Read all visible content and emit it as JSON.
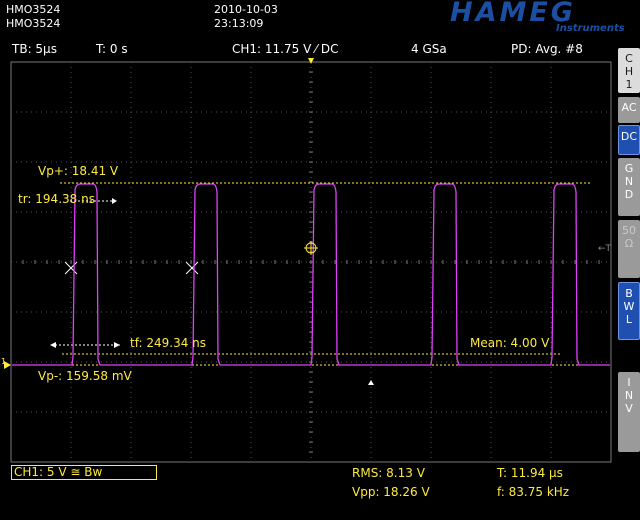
{
  "header": {
    "device_line1": "HMO3524",
    "device_line2": "HMO3524",
    "date": "2010-10-03",
    "time": "23:13:09",
    "brand": "HAMEG",
    "brand_sub": "Instruments"
  },
  "status_bar": {
    "timebase": "TB: 5µs",
    "trigger_time": "T: 0 s",
    "channel_setting": "CH1: 11.75 V ⁄ DC",
    "sample_rate": "4 GSa",
    "acquisition": "PD: Avg. #8"
  },
  "side_menu": {
    "ch1": [
      "C",
      "H",
      "1"
    ],
    "ac": "AC",
    "dc": "DC",
    "gnd": [
      "G",
      "N",
      "D"
    ],
    "fifty": [
      "50",
      "Ω"
    ],
    "bwl": [
      "B",
      "W",
      "L"
    ],
    "inv": [
      "I",
      "N",
      "V"
    ]
  },
  "measurements": {
    "vp_plus": "Vp+: 18.41 V",
    "tr": "tr: 194.38 ns",
    "mean": "Mean: 4.00 V",
    "tf": "tf: 249.34 ns",
    "vp_minus": "Vp-: 159.58 mV"
  },
  "bottom": {
    "ch1_scale": "CH1: 5 V ≅ Bw",
    "rms": "RMS: 8.13 V",
    "vpp": "Vpp: 18.26 V",
    "period": "T: 11.94 µs",
    "frequency": "f: 83.75 kHz"
  },
  "colors": {
    "trace": "#e040fb",
    "cursor": "#ffeb3b",
    "grid": "#555555",
    "brand": "#1a4fa3"
  },
  "markers": {
    "ground_marker": "1"
  }
}
